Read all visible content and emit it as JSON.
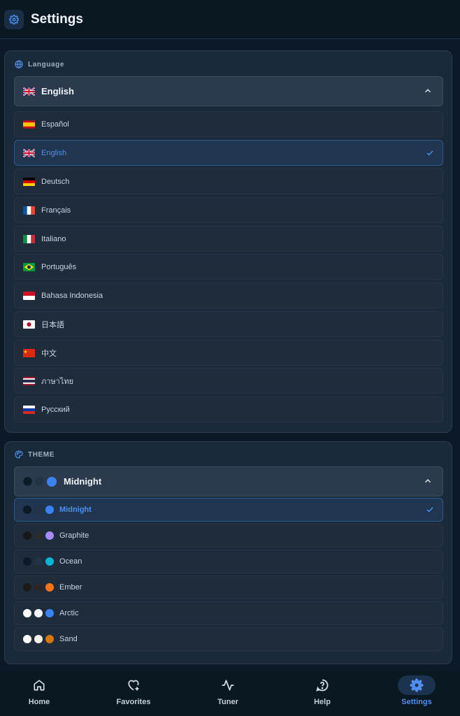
{
  "header": {
    "title": "Settings",
    "icon": "gear-icon"
  },
  "language": {
    "label": "Language",
    "selected": {
      "flag": "uk",
      "label": "English"
    },
    "options": [
      {
        "flag": "es",
        "label": "Español",
        "selected": false
      },
      {
        "flag": "uk",
        "label": "English",
        "selected": true
      },
      {
        "flag": "de",
        "label": "Deutsch",
        "selected": false
      },
      {
        "flag": "fr",
        "label": "Français",
        "selected": false
      },
      {
        "flag": "it",
        "label": "Italiano",
        "selected": false
      },
      {
        "flag": "br",
        "label": "Português",
        "selected": false
      },
      {
        "flag": "id",
        "label": "Bahasa Indonesia",
        "selected": false
      },
      {
        "flag": "jp",
        "label": "日本語",
        "selected": false
      },
      {
        "flag": "cn",
        "label": "中文",
        "selected": false
      },
      {
        "flag": "th",
        "label": "ภาษาไทย",
        "selected": false
      },
      {
        "flag": "ru",
        "label": "Русский",
        "selected": false
      }
    ]
  },
  "theme": {
    "label": "THEME",
    "selected": {
      "label": "Midnight",
      "colors": [
        "#0b1a26",
        "#243447",
        "#3b82f6"
      ]
    },
    "options": [
      {
        "label": "Midnight",
        "colors": [
          "#0b1a26",
          "#243447",
          "#3b82f6"
        ],
        "selected": true
      },
      {
        "label": "Graphite",
        "colors": [
          "#18181b",
          "#2b2b30",
          "#a78bfa"
        ],
        "selected": false
      },
      {
        "label": "Ocean",
        "colors": [
          "#0b1a26",
          "#1f3447",
          "#06b6d4"
        ],
        "selected": false
      },
      {
        "label": "Ember",
        "colors": [
          "#1c1917",
          "#2c2624",
          "#f97316"
        ],
        "selected": false
      },
      {
        "label": "Arctic",
        "colors": [
          "#ffffff",
          "#f1f5f9",
          "#3b82f6"
        ],
        "selected": false
      },
      {
        "label": "Sand",
        "colors": [
          "#ffffff",
          "#f5f0e6",
          "#d97706"
        ],
        "selected": false
      }
    ]
  },
  "nav": {
    "items": [
      {
        "label": "Home",
        "icon": "home-icon",
        "active": false
      },
      {
        "label": "Favorites",
        "icon": "heart-plus-icon",
        "active": false
      },
      {
        "label": "Tuner",
        "icon": "activity-icon",
        "active": false
      },
      {
        "label": "Help",
        "icon": "help-icon",
        "active": false
      },
      {
        "label": "Settings",
        "icon": "gear-icon",
        "active": true
      }
    ]
  },
  "colors": {
    "accent": "#4f8ff0",
    "background": "#0b1a26",
    "card": "#1b2a3a"
  }
}
